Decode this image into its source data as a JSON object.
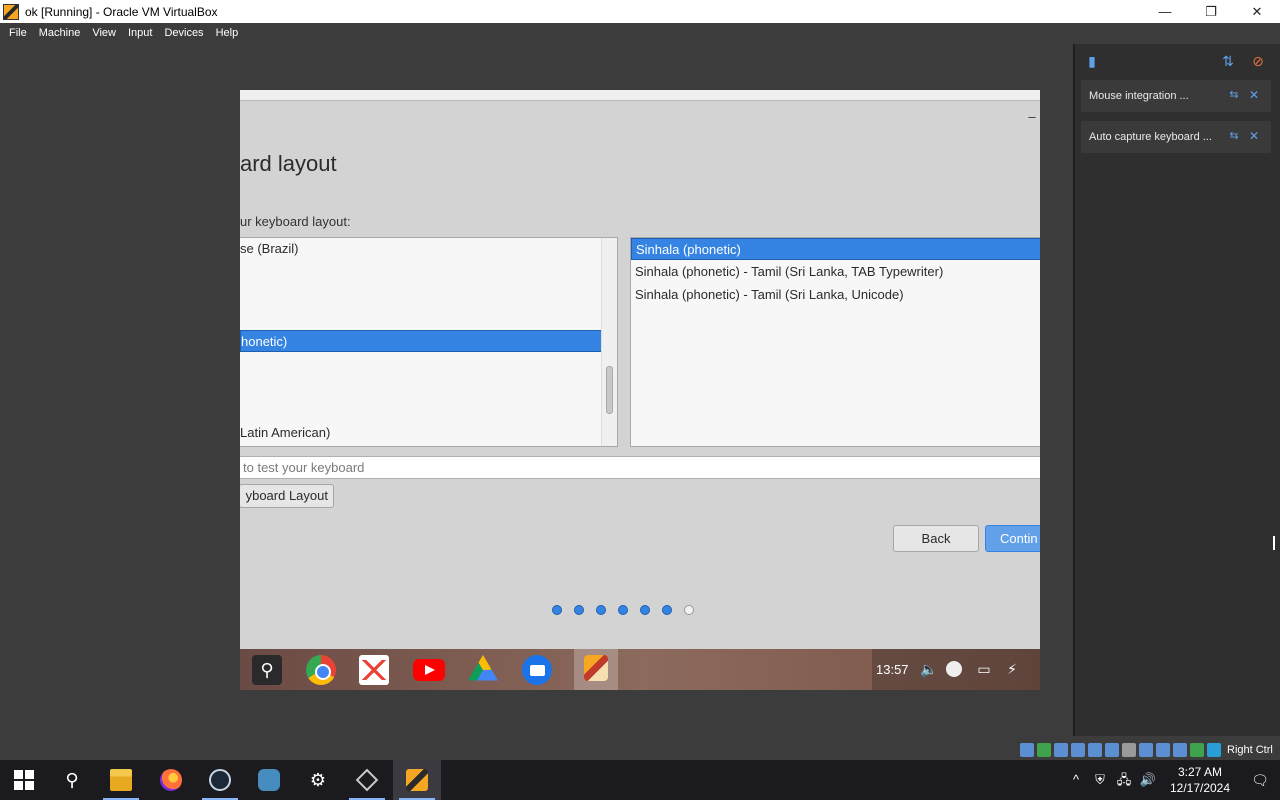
{
  "window": {
    "title": "ok [Running] - Oracle VM VirtualBox",
    "controls": {
      "minimize": "—",
      "restore": "❐",
      "close": "✕"
    }
  },
  "menubar": {
    "items": [
      "File",
      "Machine",
      "View",
      "Input",
      "Devices",
      "Help"
    ]
  },
  "installer": {
    "title": "ard layout",
    "subtitle": "ur keyboard layout:",
    "minimize_glyph": "–",
    "languages": [
      {
        "label": "se (Brazil)",
        "selected": false
      },
      {
        "label": "honetic)",
        "selected": true
      },
      {
        "label": "Latin American)",
        "selected": false
      }
    ],
    "variants": [
      {
        "label": "Sinhala (phonetic)",
        "selected": true
      },
      {
        "label": "Sinhala (phonetic) - Tamil (Sri Lanka, TAB Typewriter)",
        "selected": false
      },
      {
        "label": "Sinhala (phonetic) - Tamil (Sri Lanka, Unicode)",
        "selected": false
      }
    ],
    "test_placeholder": "to test your keyboard",
    "detect_button": "yboard Layout",
    "back_button": "Back",
    "continue_button": "Contin",
    "progress": {
      "total_steps": 7,
      "completed_steps": 6
    }
  },
  "guest_taskbar": {
    "clock": "13:57",
    "search_glyph": "⚲",
    "tray_glyphs": {
      "volume": "🔈",
      "network": "▭",
      "power": "⚡"
    }
  },
  "notifications": {
    "items": [
      {
        "label": "Mouse integration ..."
      },
      {
        "label": "Auto capture keyboard ..."
      }
    ],
    "pin_glyph": "⇆",
    "close_glyph": "✕"
  },
  "vbox_status": {
    "host_key": "Right Ctrl"
  },
  "windows_taskbar": {
    "search_glyph": "⚲",
    "gear_glyph": "⚙",
    "tray_glyphs": {
      "chevron": "^",
      "security": "⛨",
      "network": "🖧",
      "volume": "🔊",
      "notifications": "🗨"
    },
    "time": "3:27 AM",
    "date": "12/17/2024"
  }
}
